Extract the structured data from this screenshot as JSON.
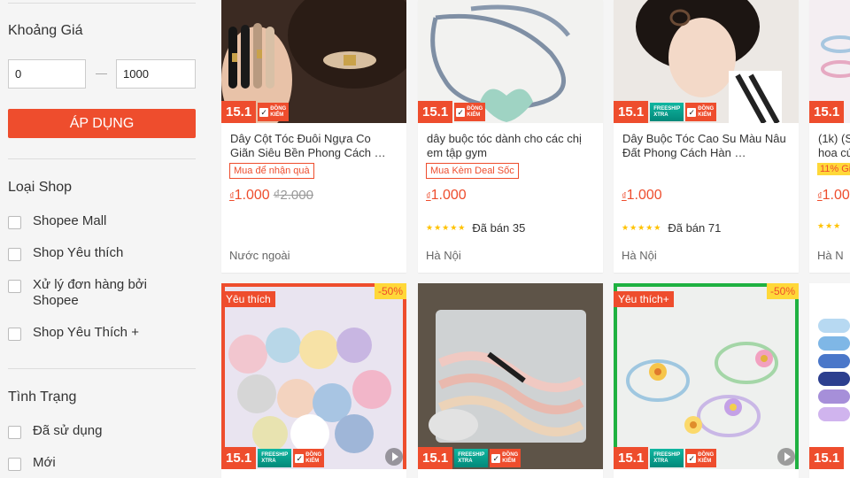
{
  "filters": {
    "price_title": "Khoảng Giá",
    "price_min": "0",
    "price_max": "1000",
    "apply_label": "ÁP DỤNG",
    "shop_title": "Loại Shop",
    "shop_options": [
      "Shopee Mall",
      "Shop Yêu thích",
      "Xử lý đơn hàng bởi Shopee",
      "Shop Yêu Thích +"
    ],
    "condition_title": "Tình Trạng",
    "condition_options": [
      "Đã sử dụng",
      "Mới"
    ]
  },
  "badges": {
    "campaign": "15.1",
    "freeship_top": "FREESHIP",
    "freeship_bottom": "XTRA",
    "dongkiem_top": "ĐỒNG",
    "dongkiem_bottom": "KIỂM",
    "check": "✓",
    "fav": "Yêu thích",
    "fav_plus": "Yêu thích+",
    "discount": "-50%",
    "percent_off": "11% Gi"
  },
  "products": [
    {
      "name": "Dây Cột Tóc Đuôi Ngựa Co Giãn Siêu Bền Phong Cách …",
      "tag": "Mua để nhận quà",
      "currency": "₫",
      "price": "1.000",
      "old_price": "₫2.000",
      "location": "Nước ngoài"
    },
    {
      "name": "dây buộc tóc dành cho các chị em tập gym",
      "tag": "Mua Kèm Deal Sốc",
      "currency": "₫",
      "price": "1.000",
      "stars": "★★★★★",
      "sold": "Đã bán 35",
      "location": "Hà Nội"
    },
    {
      "name": "Dây Buộc Tóc Cao Su Màu Nâu Đất Phong Cách Hàn …",
      "currency": "₫",
      "price": "1.000",
      "stars": "★★★★★",
      "sold": "Đã bán 71",
      "location": "Hà Nội"
    },
    {
      "name": "(1k) (S hoa cú",
      "currency": "₫",
      "price": "1.00",
      "stars": "★★★",
      "location": "Hà N"
    }
  ],
  "colors": {
    "accent": "#ee4d2d",
    "star": "#ffc200",
    "freeship": "#00bfa5"
  },
  "icons": [
    "checkbox-icon",
    "check-icon",
    "play-icon",
    "star-icon"
  ]
}
